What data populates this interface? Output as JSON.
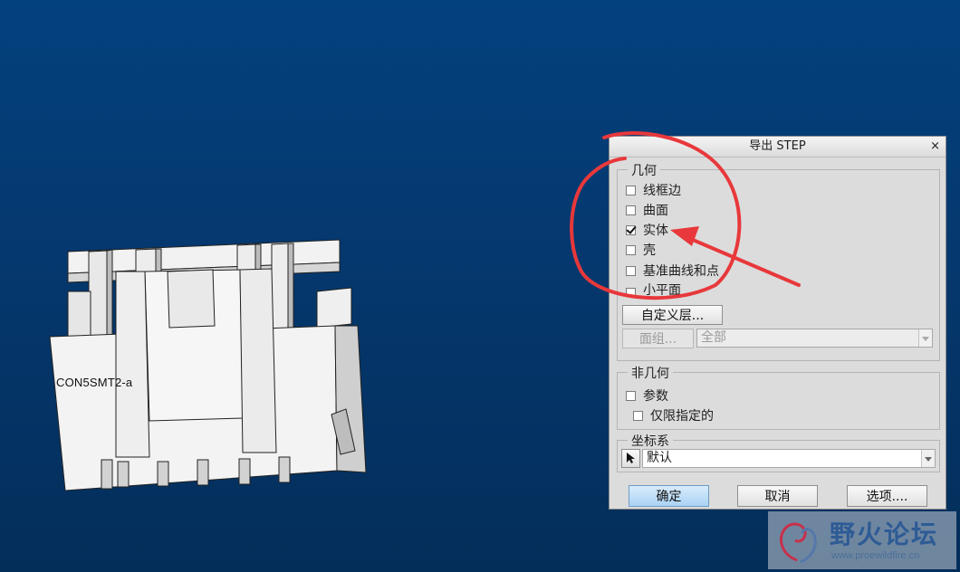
{
  "viewport": {
    "model_label": "CON5SMT2-a"
  },
  "dialog": {
    "title": "导出 STEP",
    "close_glyph": "×",
    "geometry": {
      "title": "几何",
      "options": [
        {
          "label": "线框边",
          "checked": false
        },
        {
          "label": "曲面",
          "checked": false
        },
        {
          "label": "实体",
          "checked": true
        },
        {
          "label": "壳",
          "checked": false
        },
        {
          "label": "基准曲线和点",
          "checked": false
        },
        {
          "label": "小平面",
          "checked": false
        }
      ],
      "custom_layer_button": "自定义层...",
      "face_group_button": "面组...",
      "face_group_select": "全部"
    },
    "non_geometry": {
      "title": "非几何",
      "parameters_label": "参数",
      "parameters_checked": false,
      "specified_only_label": "仅限指定的",
      "specified_only_checked": false
    },
    "coordinate_system": {
      "title": "坐标系",
      "select_icon": "pointer-arrow-icon",
      "value": "默认"
    },
    "buttons": {
      "ok": "确定",
      "cancel": "取消",
      "options": "选项...."
    }
  },
  "watermark": {
    "title": "野火论坛",
    "url": "www.proewildfire.cn"
  },
  "colors": {
    "background_top": "#03417e",
    "annotation_red": "#e8383b"
  }
}
